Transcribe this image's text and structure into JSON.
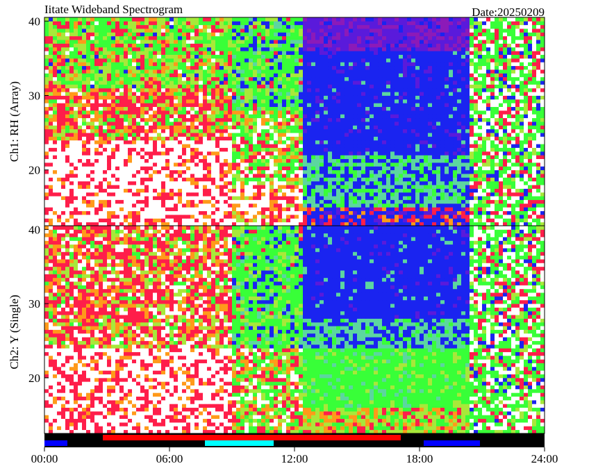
{
  "header": {
    "title": "Iitate Wideband Spectrogram",
    "date_label": "Date:20250209"
  },
  "panels": [
    {
      "id": "ch1",
      "ylabel": "Ch1: RH (Array)"
    },
    {
      "id": "ch2",
      "ylabel": "Ch2: Y (Single)"
    }
  ],
  "colors": {
    "white": "#ffffff",
    "red": "#ff1e4a",
    "orange": "#ff9a1a",
    "yellow_green": "#a8e83a",
    "green": "#38ff38",
    "cyan_green": "#5cd6a0",
    "blue": "#1a24f0",
    "violet": "#5a1adb",
    "purple": "#8c1ab8",
    "bar_background": "#000000",
    "bar_red": "#ff0000",
    "bar_cyan": "#00ffff",
    "bar_blue": "#0000ff"
  },
  "chart_data": [
    {
      "type": "heatmap",
      "title": "Iitate Wideband Spectrogram",
      "ylabel": "Ch1: RH (Array)",
      "xlabel": "",
      "x_ticks": [
        "00:00",
        "06:00",
        "12:00",
        "18:00",
        "24:00"
      ],
      "xlim_hours": [
        0,
        24
      ],
      "y_ticks": [
        20,
        30,
        40
      ],
      "ylim": [
        12.5,
        40.5
      ],
      "color_scale_low_to_high": [
        "blue",
        "violet",
        "cyan_green",
        "green",
        "yellow_green",
        "orange",
        "red",
        "white"
      ],
      "regions": [
        {
          "t": [
            0,
            9
          ],
          "f": [
            31,
            40.5
          ],
          "level": "noisy",
          "dominant": "green/red"
        },
        {
          "t": [
            0,
            9
          ],
          "f": [
            12.5,
            24
          ],
          "level": "saturated",
          "dominant": "white"
        },
        {
          "t": [
            9,
            12.5
          ],
          "f": [
            12.5,
            40.5
          ],
          "level": "transition",
          "dominant": "green"
        },
        {
          "t": [
            12.5,
            20.5
          ],
          "f": [
            36,
            40.5
          ],
          "level": "low",
          "dominant": "violet"
        },
        {
          "t": [
            12.5,
            20.5
          ],
          "f": [
            22,
            36
          ],
          "level": "low",
          "dominant": "blue"
        },
        {
          "t": [
            13,
            20
          ],
          "f": [
            15,
            22
          ],
          "level": "moderate",
          "dominant": "green"
        },
        {
          "t": [
            20.5,
            24
          ],
          "f": [
            12.5,
            40.5
          ],
          "level": "noisy",
          "dominant": "green/white"
        }
      ]
    },
    {
      "type": "heatmap",
      "ylabel": "Ch2: Y (Single)",
      "xlabel": "",
      "x_ticks": [
        "00:00",
        "06:00",
        "12:00",
        "18:00",
        "24:00"
      ],
      "xlim_hours": [
        0,
        24
      ],
      "y_ticks": [
        20,
        30,
        40
      ],
      "ylim": [
        12.5,
        40.5
      ],
      "color_scale_low_to_high": [
        "blue",
        "violet",
        "cyan_green",
        "green",
        "yellow_green",
        "orange",
        "red",
        "white"
      ],
      "regions": [
        {
          "t": [
            0,
            9
          ],
          "f": [
            12.5,
            40.5
          ],
          "level": "saturated",
          "dominant": "red/white"
        },
        {
          "t": [
            9,
            12.5
          ],
          "f": [
            12.5,
            40.5
          ],
          "level": "transition",
          "dominant": "green"
        },
        {
          "t": [
            12.5,
            20.5
          ],
          "f": [
            28,
            40.5
          ],
          "level": "low",
          "dominant": "blue"
        },
        {
          "t": [
            12.5,
            20.5
          ],
          "f": [
            16,
            28
          ],
          "level": "moderate",
          "dominant": "green"
        },
        {
          "t": [
            13,
            20
          ],
          "f": [
            12.5,
            16
          ],
          "level": "high",
          "dominant": "yellow_green"
        },
        {
          "t": [
            20.5,
            24
          ],
          "f": [
            12.5,
            40.5
          ],
          "level": "noisy",
          "dominant": "green/white"
        }
      ]
    }
  ],
  "status_bar": {
    "segments": [
      {
        "start_h": 0.0,
        "end_h": 1.1,
        "row": "bottom",
        "color": "bar_blue"
      },
      {
        "start_h": 2.8,
        "end_h": 17.1,
        "row": "top",
        "color": "bar_red"
      },
      {
        "start_h": 7.7,
        "end_h": 11.0,
        "row": "bottom",
        "color": "bar_cyan"
      },
      {
        "start_h": 18.2,
        "end_h": 20.9,
        "row": "bottom",
        "color": "bar_blue"
      }
    ]
  }
}
